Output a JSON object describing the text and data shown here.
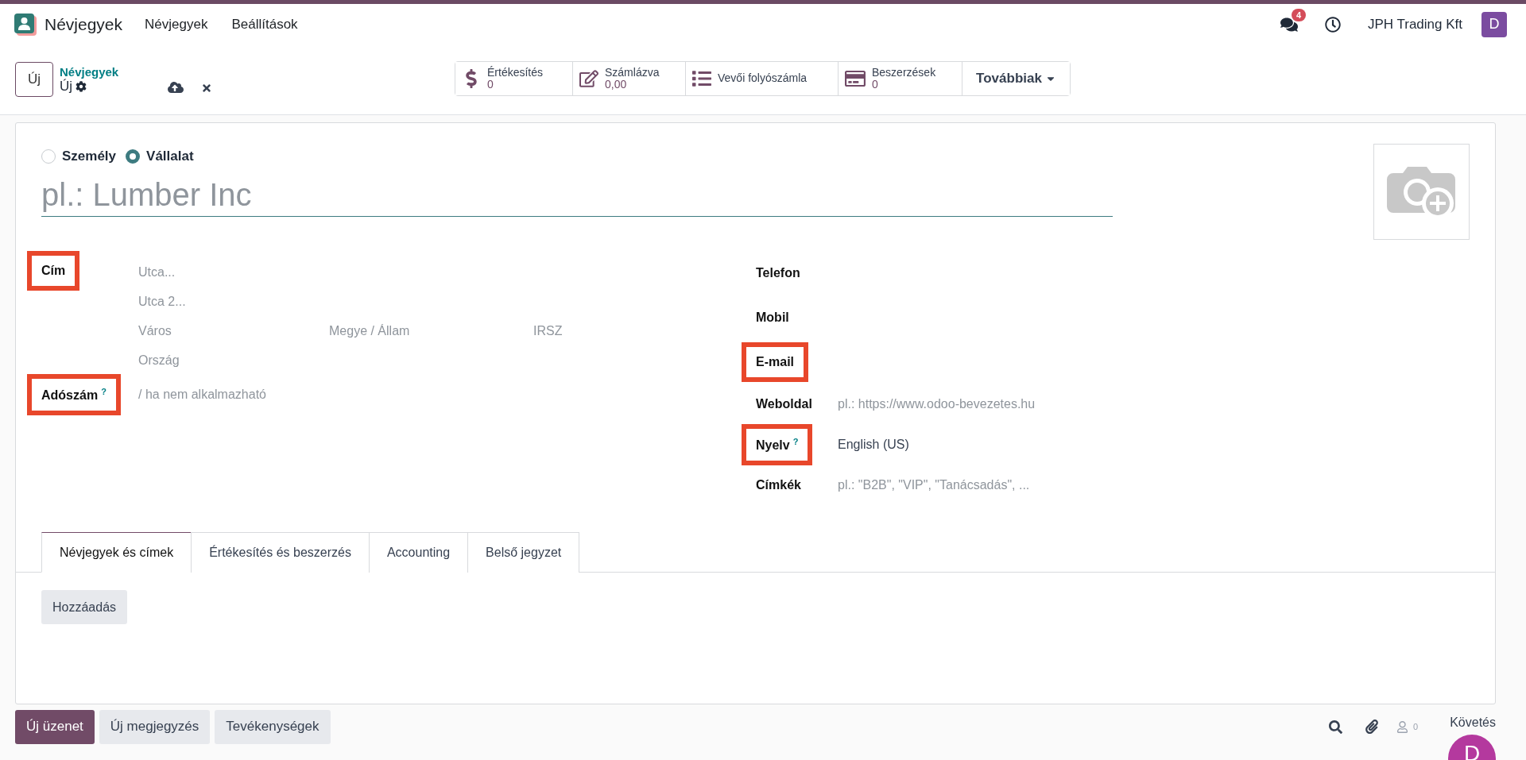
{
  "navbar": {
    "app_name": "Névjegyek",
    "menu": [
      "Névjegyek",
      "Beállítások"
    ],
    "messages_count": "4",
    "company": "JPH Trading Kft",
    "avatar": "D"
  },
  "control_panel": {
    "new_button": "Új",
    "breadcrumb": "Névjegyek",
    "record": "Új",
    "smart_buttons": [
      {
        "kind": "stat",
        "label": "Értékesítés",
        "value": "0"
      },
      {
        "kind": "stat",
        "label": "Számlázva",
        "value": "0,00"
      },
      {
        "kind": "plain",
        "label": "Vevői folyószámla"
      },
      {
        "kind": "stat",
        "label": "Beszerzések",
        "value": "0"
      },
      {
        "kind": "more",
        "label": "Továbbiak"
      }
    ]
  },
  "form": {
    "company_type": [
      {
        "label": "Személy",
        "selected": false
      },
      {
        "label": "Vállalat",
        "selected": true
      }
    ],
    "name": {
      "placeholder": "pl.: Lumber Inc"
    },
    "address": {
      "label": "Cím",
      "highlighted": true,
      "street_placeholder": "Utca...",
      "street2_placeholder": "Utca 2...",
      "city_placeholder": "Város",
      "state_placeholder": "Megye / Állam",
      "zip_placeholder": "IRSZ",
      "country_placeholder": "Ország"
    },
    "vat": {
      "label": "Adószám",
      "help": "?",
      "highlighted": true,
      "placeholder": "/ ha nem alkalmazható"
    },
    "right_fields": [
      {
        "label": "Telefon",
        "highlighted": false
      },
      {
        "label": "Mobil",
        "highlighted": false
      },
      {
        "label": "E-mail",
        "highlighted": true
      },
      {
        "label": "Weboldal",
        "highlighted": false,
        "placeholder": "pl.: https://www.odoo-bevezetes.hu"
      },
      {
        "label": "Nyelv",
        "help": "?",
        "highlighted": true,
        "value": "English (US)"
      },
      {
        "label": "Címkék",
        "highlighted": false,
        "placeholder": "pl.: \"B2B\", \"VIP\", \"Tanácsadás\", ..."
      }
    ],
    "tabs": [
      {
        "label": "Névjegyek és címek",
        "selected": true
      },
      {
        "label": "Értékesítés és beszerzés",
        "selected": false
      },
      {
        "label": "Accounting",
        "selected": false
      },
      {
        "label": "Belső jegyzet",
        "selected": false
      }
    ],
    "add_button": "Hozzáadás"
  },
  "chatter": {
    "buttons": [
      {
        "label": "Új üzenet",
        "primary": true
      },
      {
        "label": "Új megjegyzés",
        "primary": false
      },
      {
        "label": "Tevékenységek",
        "primary": false
      }
    ],
    "followers_count": "0",
    "follow": "Követés",
    "avatar": "D"
  }
}
